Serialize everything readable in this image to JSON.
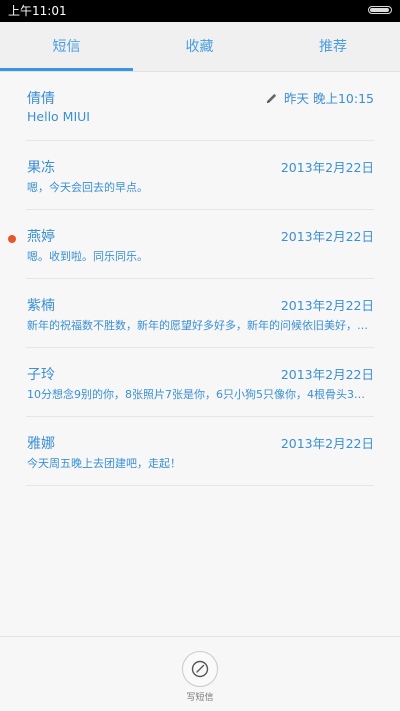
{
  "status_bar": {
    "time": "上午11:01",
    "battery_icon": "battery-icon"
  },
  "tabs": [
    {
      "label": "短信",
      "active": true
    },
    {
      "label": "收藏",
      "active": false
    },
    {
      "label": "推荐",
      "active": false
    }
  ],
  "conversations": [
    {
      "name": "倩倩",
      "preview": "Hello MIUI",
      "date": "昨天 晚上10:15",
      "draft": true,
      "unread": false
    },
    {
      "name": "果冻",
      "preview": "嗯，今天会回去的早点。",
      "date": "2013年2月22日",
      "draft": false,
      "unread": false
    },
    {
      "name": "燕婷",
      "preview": "嗯。收到啦。同乐同乐。",
      "date": "2013年2月22日",
      "draft": false,
      "unread": true
    },
    {
      "name": "紫楠",
      "preview": "新年的祝福数不胜数，新年的愿望好多好多，新年的问候依旧美好，新年的",
      "date": "2013年2月22日",
      "draft": false,
      "unread": false
    },
    {
      "name": "子玲",
      "preview": "10分想念9别的你，8张照片7张是你，6只小狗5只像你，4根骨头3根给你",
      "date": "2013年2月22日",
      "draft": false,
      "unread": false
    },
    {
      "name": "雅娜",
      "preview": "今天周五晚上去团建吧，走起！",
      "date": "2013年2月22日",
      "draft": false,
      "unread": false
    }
  ],
  "compose": {
    "label": "写短信",
    "icon": "compose-icon"
  },
  "colors": {
    "accent": "#3a96e4",
    "unread_dot": "#e8562a",
    "text": "#3a8fd6"
  }
}
